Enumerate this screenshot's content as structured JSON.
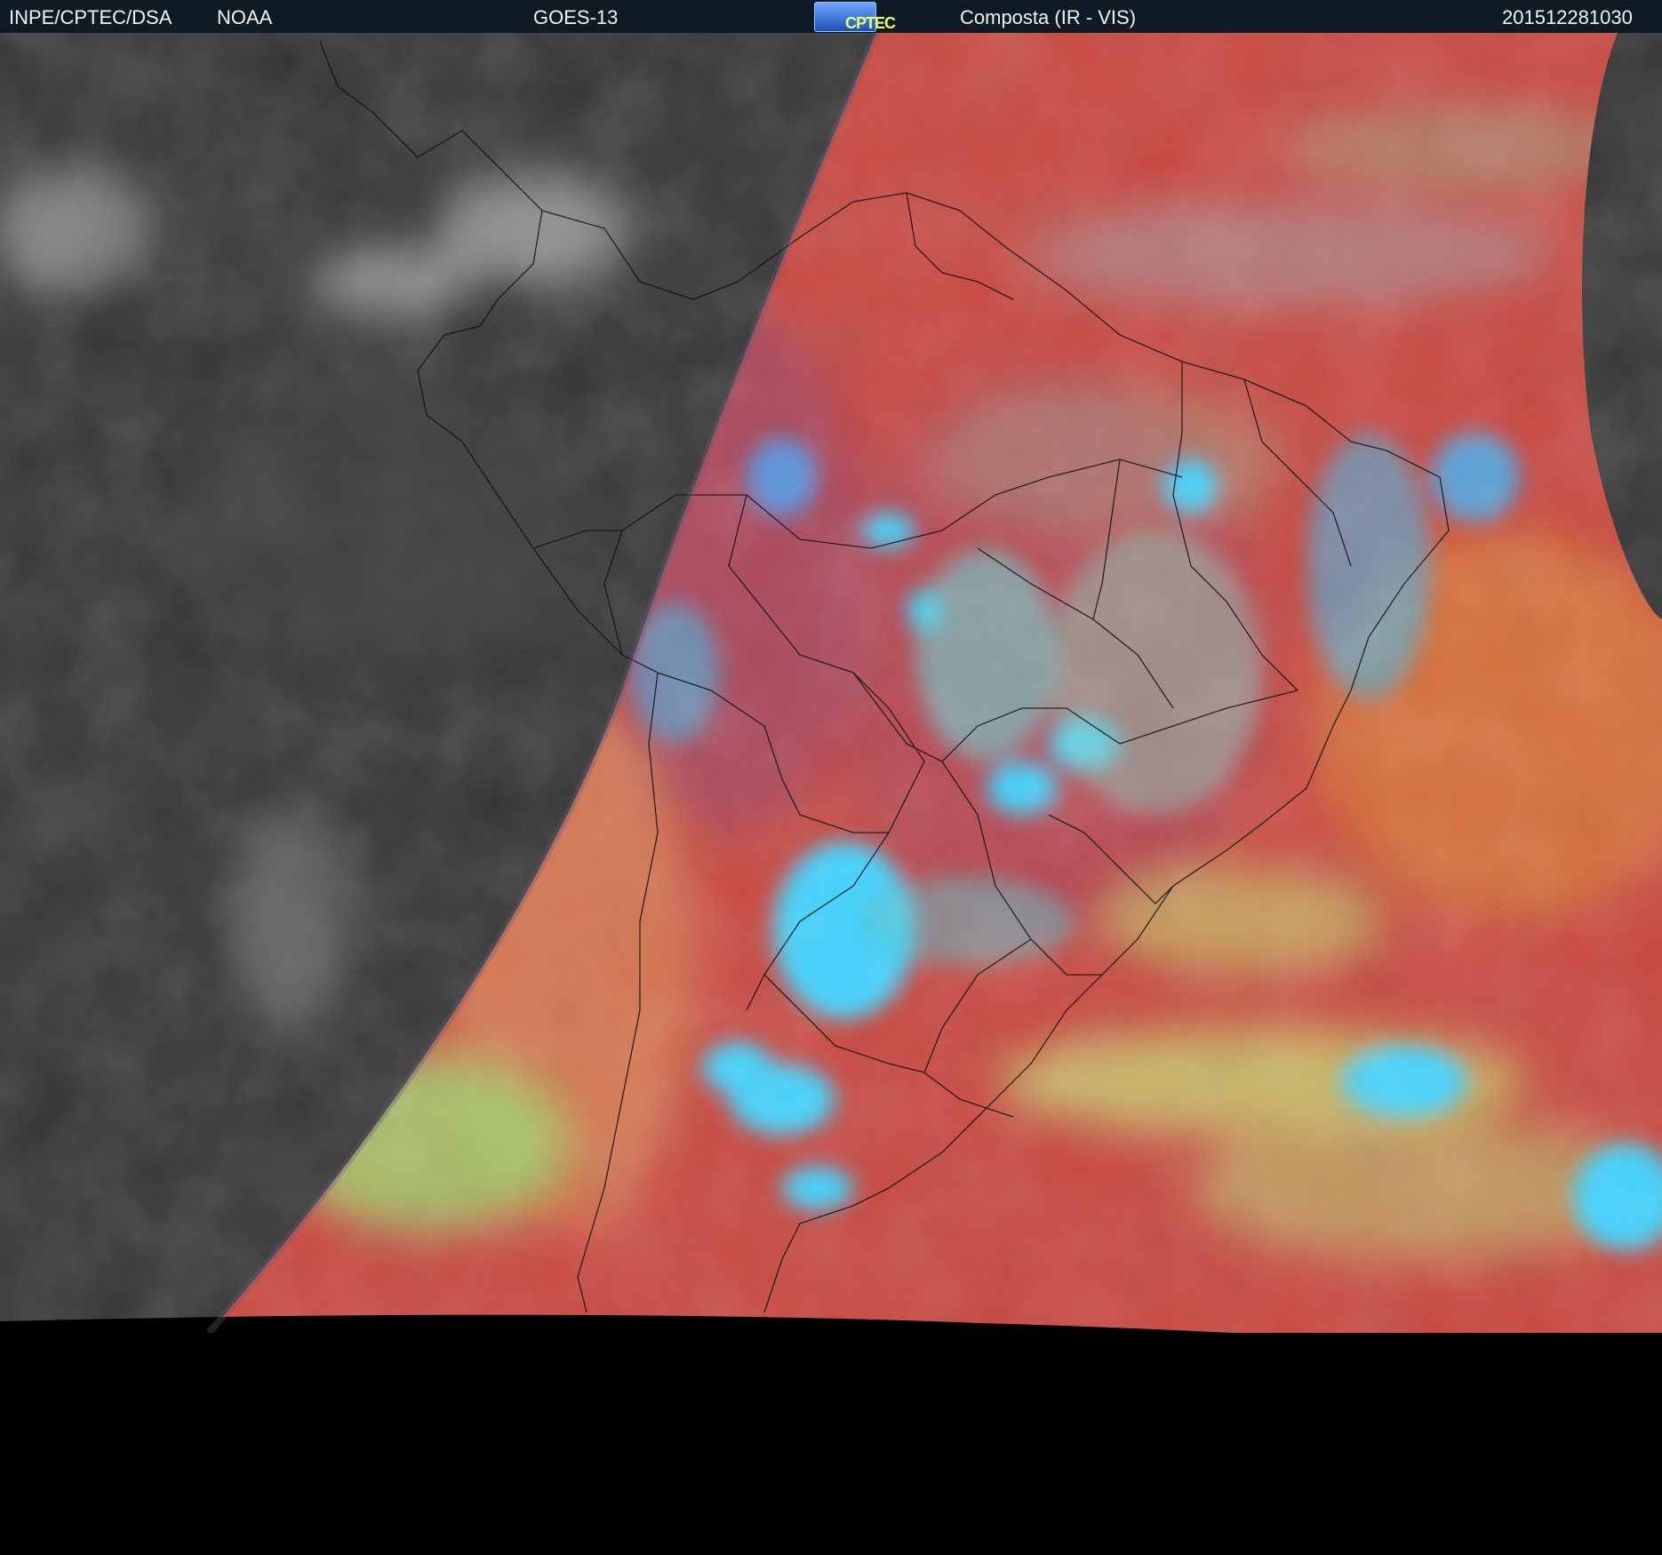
{
  "header": {
    "agency": "INPE/CPTEC/DSA",
    "provider": "NOAA",
    "satellite": "GOES-13",
    "logo_text": "CPTEC",
    "product": "Composta (IR - VIS)",
    "timestamp": "201512281030"
  },
  "colors": {
    "header_bg": "#0e1a24",
    "night_side": "#3a3a3a",
    "ocean_warm": "#c9493f",
    "ocean_orange": "#d97a3c",
    "cloud_cold": "#44d4ff",
    "cloud_mid": "#a0d86e",
    "land_mix": "#b24a55",
    "background": "#000000"
  }
}
